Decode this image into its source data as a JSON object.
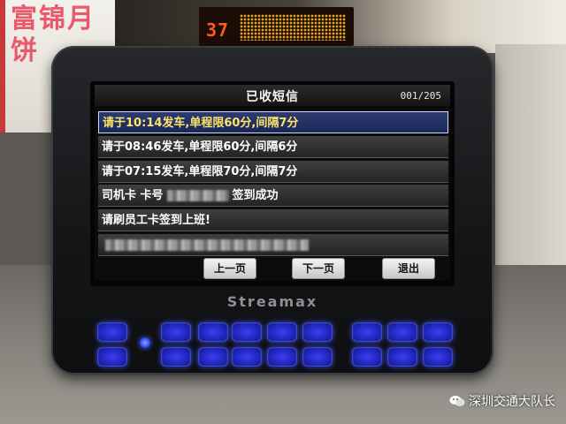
{
  "background": {
    "sign_text": "富锦月饼",
    "route_number": "37"
  },
  "screen": {
    "title": "已收短信",
    "page_counter": "001/205",
    "messages": [
      {
        "text": "请于10:14发车,单程限60分,间隔7分",
        "selected": true
      },
      {
        "text": "请于08:46发车,单程限60分,间隔6分",
        "selected": false
      },
      {
        "text": "请于07:15发车,单程限70分,间隔7分",
        "selected": false
      },
      {
        "prefix": "司机卡 卡号",
        "suffix": "签到成功",
        "selected": false
      },
      {
        "text": "请刷员工卡签到上班!",
        "selected": false
      },
      {
        "text": "",
        "selected": false
      }
    ],
    "buttons": {
      "prev": "上一页",
      "next": "下一页",
      "exit": "退出"
    }
  },
  "device": {
    "brand": "Streamax"
  },
  "watermark": {
    "text": "深圳交通大队长"
  },
  "colors": {
    "selected_row": "#1a2755",
    "selected_text": "#ffe36a",
    "key_glow": "#3a4cff"
  }
}
